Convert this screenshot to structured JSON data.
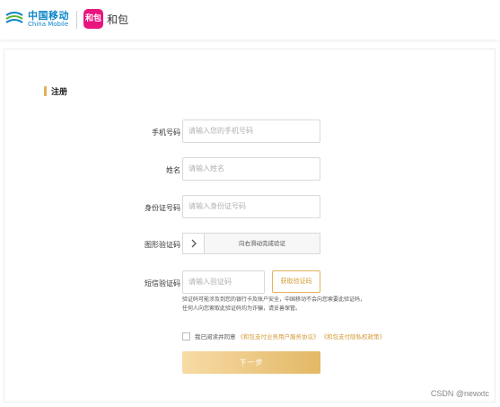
{
  "header": {
    "brand_cn": "中国移动",
    "brand_en": "China Mobile",
    "app_logo_text": "和包",
    "app_name": "和包"
  },
  "form": {
    "title": "注册",
    "fields": [
      {
        "label": "手机号码",
        "placeholder": "请输入您的手机号码"
      },
      {
        "label": "姓名",
        "placeholder": "请输入姓名"
      },
      {
        "label": "身份证号码",
        "placeholder": "请输入身份证号码"
      }
    ],
    "captcha": {
      "label": "图形验证码",
      "slider_text": "向右滑动完成验证"
    },
    "sms": {
      "label": "短信验证码",
      "placeholder": "请输入验证码",
      "button": "获取验证码"
    },
    "notice_line1": "验证码可能涉及到您的银行卡及账户安全，中国移动不会向您索要此验证码，",
    "notice_line2": "任何人向您索取此验证码均为诈骗，请妥善保管。",
    "agree_text": "我已阅读并同意",
    "agree_link1": "《和包支付业务用户服务协议》",
    "agree_link2": "《和包支付隐私权政策》",
    "next_button": "下一步"
  },
  "watermark": "CSDN @newxtc",
  "colors": {
    "accent": "#e3b35a",
    "brand_blue": "#0b84c9",
    "app_pink": "#e9157f"
  }
}
